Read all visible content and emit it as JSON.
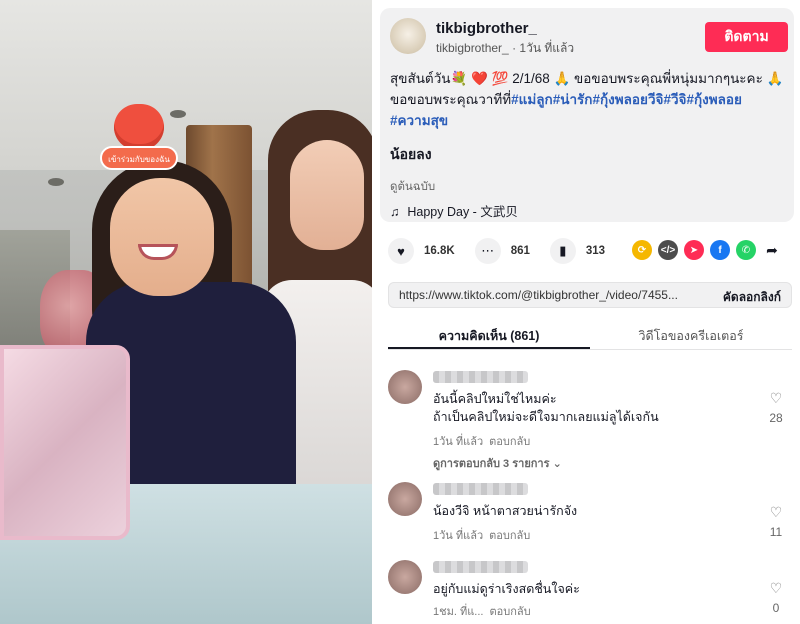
{
  "video": {
    "sticker_text": "เข้าร่วมกับของฉัน"
  },
  "author": {
    "username": "tikbigbrother_",
    "handle": "tikbigbrother_",
    "time_ago": "1วัน ที่แล้ว",
    "follow_label": "ติดตาม"
  },
  "caption": {
    "line1": "สุขสันต์วัน💐 ❤️ 💯 2/1/68 🙏 ขอขอบพระคุณพี่หนุ่มมากๆนะคะ 🙏 ขอขอบพระคุณวาทีที่",
    "tags": [
      "#แม่ลูก",
      "#น่ารัก",
      "#กุ้งพลอยวีจิ",
      "#วีจิ",
      "#กุ้งพลอย",
      "#ความสุข"
    ],
    "extra": "น้อยลง",
    "original": "ดูต้นฉบับ",
    "music": "Happy Day - 文武贝"
  },
  "stats": {
    "likes": "16.8K",
    "comments": "861",
    "saves": "313"
  },
  "share": {
    "icons": [
      "repost-icon",
      "embed-icon",
      "send-icon",
      "facebook-icon",
      "whatsapp-icon",
      "share-icon"
    ],
    "colors": [
      "#f5b700",
      "#4d4d4d",
      "#fe2c55",
      "#1877f2",
      "#25d366",
      "#161823"
    ]
  },
  "link": {
    "url": "https://www.tiktok.com/@tikbigbrother_/video/7455...",
    "copy_label": "คัดลอกลิงก์"
  },
  "tabs": {
    "comments": "ความคิดเห็น (861)",
    "creator_videos": "วิดีโอของครีเอเตอร์"
  },
  "comments": [
    {
      "text_line1": "อันนี้คลิปใหม่ใช่ไหมค่ะ",
      "text_line2": "ถ้าเป็นคลิปใหม่จะดีใจมากเลยแม่ลูได้เจกัน",
      "time": "1วัน ที่แล้ว",
      "reply": "ตอบกลับ",
      "view_replies": "ดูการตอบกลับ 3 รายการ ⌄",
      "likes": "28"
    },
    {
      "text_line1": "น้องวีจิ หน้าตาสวยน่ารักจัง",
      "text_line2": "",
      "time": "1วัน ที่แล้ว",
      "reply": "ตอบกลับ",
      "view_replies": "",
      "likes": "11"
    },
    {
      "text_line1": "อยู่กับแม่ดูร่าเริงสดชื่นใจค่ะ",
      "text_line2": "",
      "time": "1ชม. ที่แ...",
      "reply": "ตอบกลับ",
      "view_replies": "",
      "likes": "0"
    }
  ]
}
